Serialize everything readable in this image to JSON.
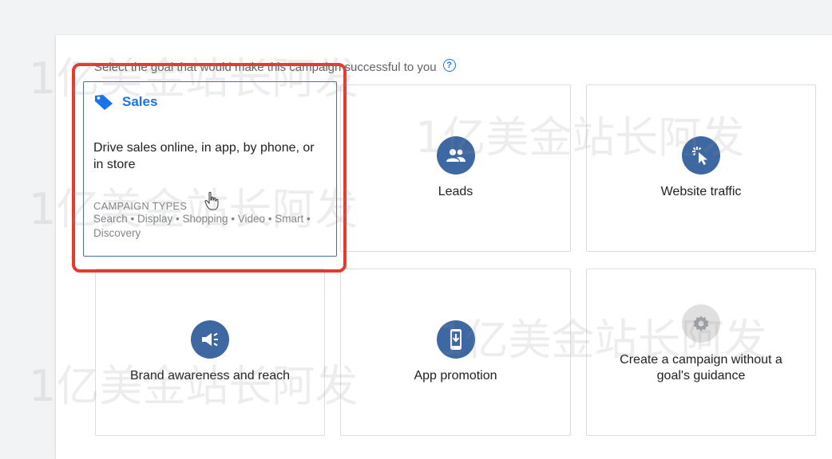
{
  "prompt": {
    "text": "Select the goal that would make this campaign successful to you",
    "help_icon": "help-circle-icon"
  },
  "cards": {
    "sales": {
      "title": "Sales",
      "icon": "tag-icon",
      "description": "Drive sales online, in app, by phone, or in store",
      "campaign_types_label": "CAMPAIGN TYPES",
      "campaign_types": "Search • Display • Shopping • Video • Smart • Discovery",
      "selected": true
    },
    "leads": {
      "label": "Leads",
      "icon": "people-icon"
    },
    "website_traffic": {
      "label": "Website traffic",
      "icon": "cursor-click-icon"
    },
    "brand_awareness": {
      "label": "Brand awareness and reach",
      "icon": "megaphone-icon"
    },
    "app_promotion": {
      "label": "App promotion",
      "icon": "phone-download-icon"
    },
    "no_goal": {
      "label": "Create a campaign without a goal's guidance",
      "icon": "gear-icon"
    }
  },
  "colors": {
    "accent": "#1a73e8",
    "icon_circle": "#3e68a2",
    "highlight": "#e53a2f"
  },
  "watermark": "1亿美金站长阿发"
}
